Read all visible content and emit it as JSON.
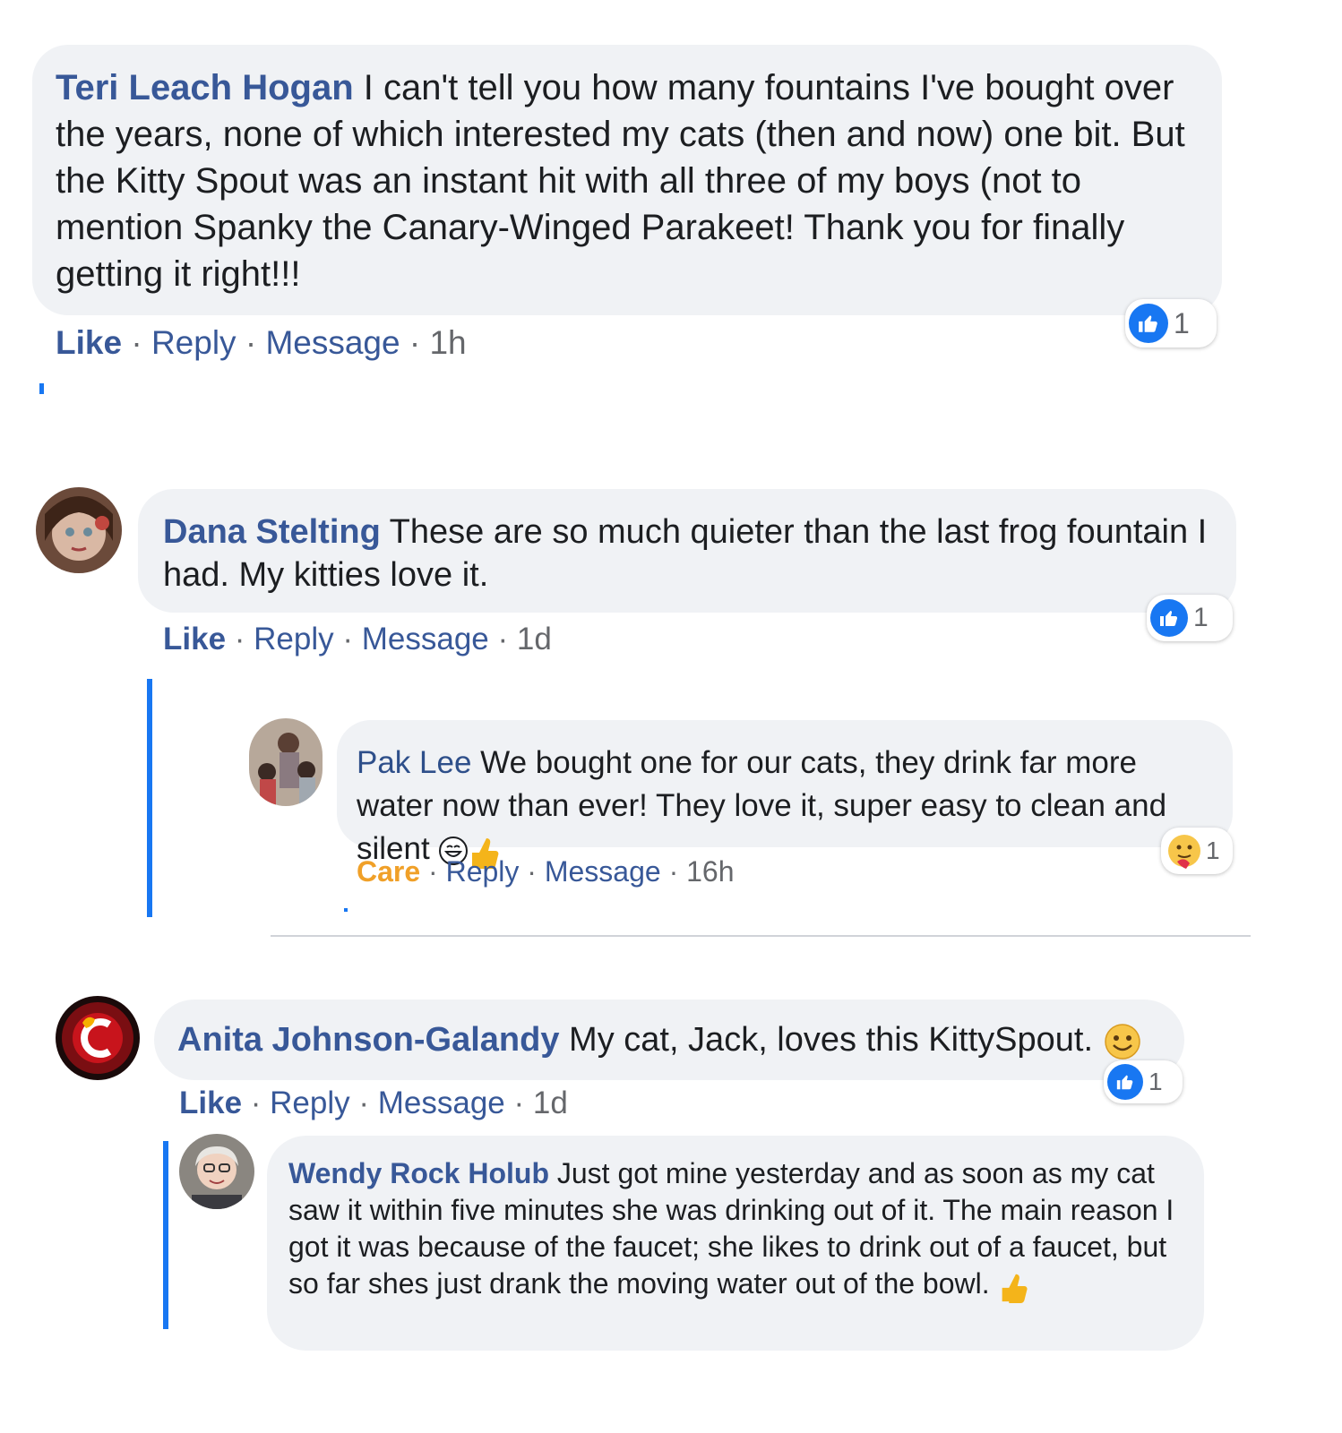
{
  "comments": [
    {
      "name": "Teri Leach Hogan",
      "text": " I can't tell you how many fountains I've bought over the years, none of which interested my cats (then and now) one bit. But the Kitty Spout was an instant hit with all three of my boys (not to mention Spanky the Canary-Winged Parakeet! Thank you for finally getting it right!!!",
      "actions": {
        "like": "Like",
        "reply": "Reply",
        "message": "Message",
        "time": "1h",
        "sep": " · "
      },
      "reaction": {
        "icon": "thumbs-up-icon",
        "count": "1"
      }
    },
    {
      "name": "Dana Stelting",
      "text": " These are so much quieter than the last frog fountain I had. My kitties love it.",
      "actions": {
        "like": "Like",
        "reply": "Reply",
        "message": "Message",
        "time": "1d",
        "sep": " · "
      },
      "reaction": {
        "icon": "thumbs-up-icon",
        "count": "1"
      }
    },
    {
      "name": "Pak Lee",
      "text": " We bought one for our cats, they drink far more water now than ever! They love it, super easy to clean and silent ",
      "emojis": [
        "grinning-face-icon",
        "thumbs-up-hand-icon"
      ],
      "actions": {
        "like": "Care",
        "reply": "Reply",
        "message": "Message",
        "time": "16h",
        "sep": " · "
      },
      "reaction": {
        "icon": "care-reaction-icon",
        "count": "1"
      }
    },
    {
      "name": "Anita Johnson-Galandy",
      "text": " My cat, Jack, loves this KittySpout. ",
      "emojis": [
        "smiling-face-icon"
      ],
      "actions": {
        "like": "Like",
        "reply": "Reply",
        "message": "Message",
        "time": "1d",
        "sep": " · "
      },
      "reaction": {
        "icon": "thumbs-up-icon",
        "count": "1"
      }
    },
    {
      "name": "Wendy Rock Holub",
      "text": " Just got mine yesterday and as soon as my cat saw it within five minutes she was drinking out of it. The main reason I got it was because of the faucet; she likes to drink out of a faucet, but so far shes just drank the moving water out of the bowl. ",
      "emojis": [
        "thumbs-up-hand-icon"
      ]
    }
  ],
  "colors": {
    "name": "#385898",
    "like_blue": "#1877f2",
    "care": "#f0a028",
    "bubble": "#f0f2f5"
  }
}
